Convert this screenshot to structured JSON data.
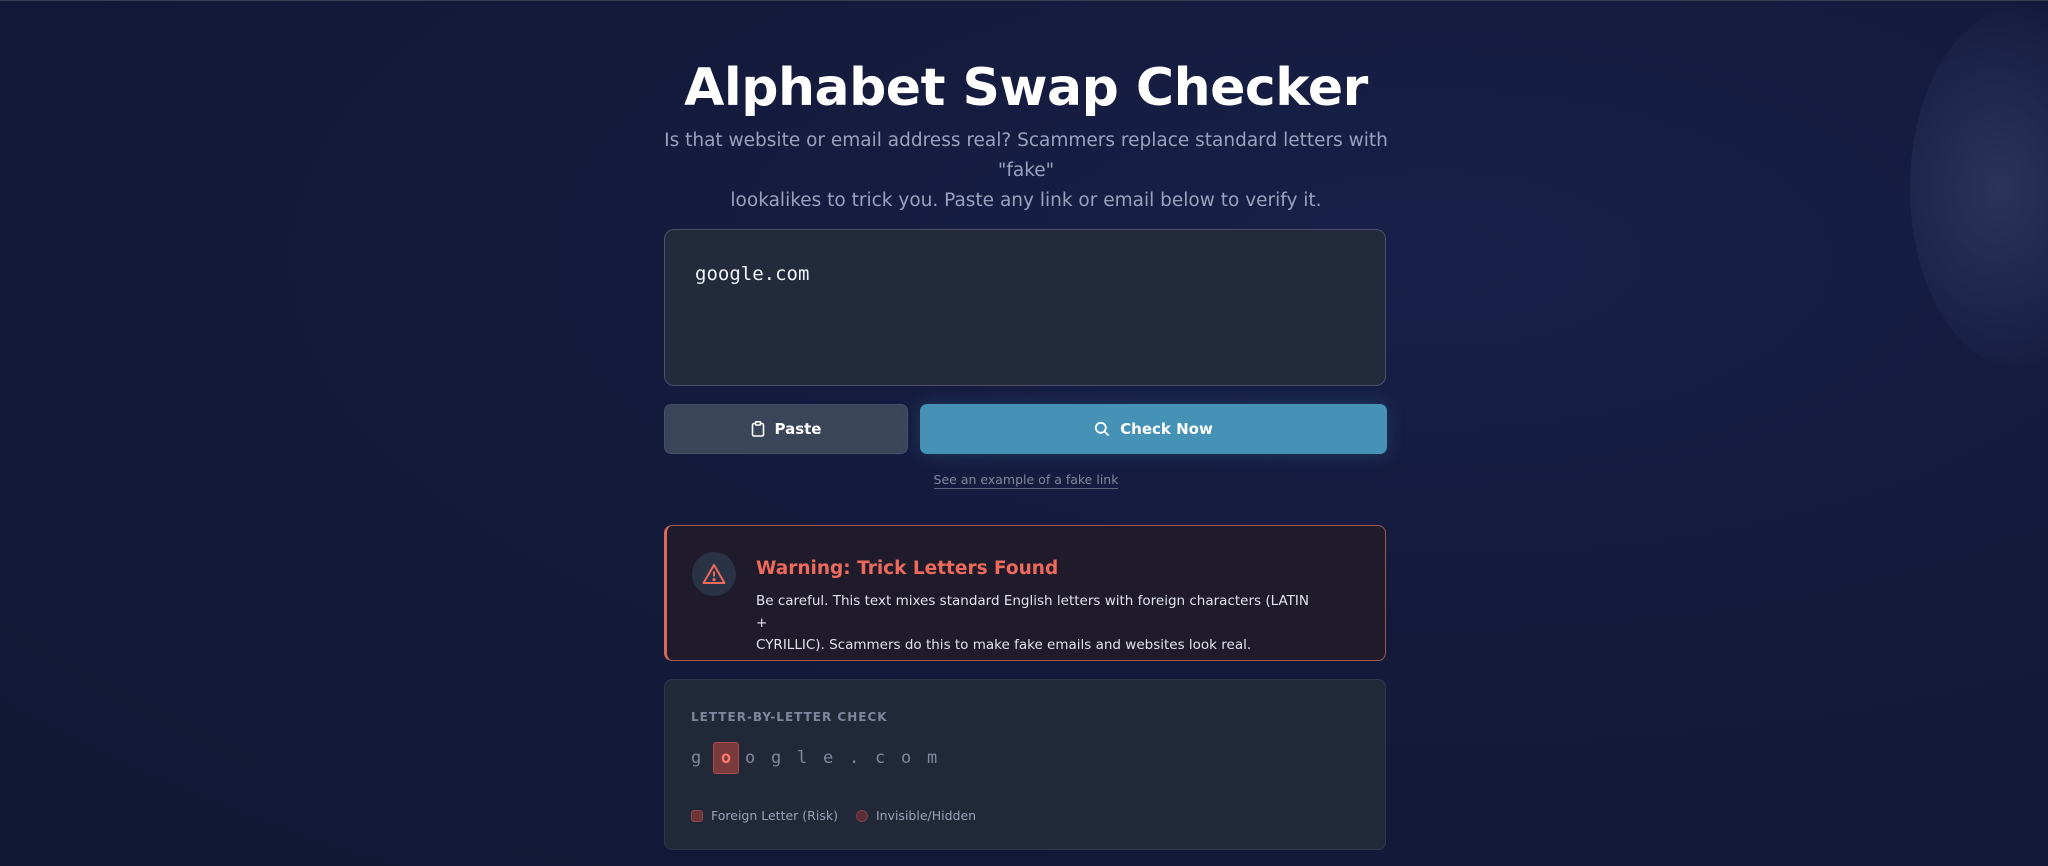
{
  "app": {
    "title": "Alphabet Swap Checker",
    "subtitle_line1": "Is that website or email address real? Scammers replace standard letters with \"fake\"",
    "subtitle_line2": "lookalikes to trick you. Paste any link or email below to verify it."
  },
  "input": {
    "value": "google.com"
  },
  "actions": {
    "paste_label": "Paste",
    "paste_icon": "clipboard-icon",
    "check_label": "Check Now",
    "check_icon": "search-icon",
    "example_link": "See an example of a fake link"
  },
  "warning": {
    "icon": "warning-triangle-icon",
    "title": "Warning: Trick Letters Found",
    "text_line1": "Be careful. This text mixes standard English letters with foreign characters (LATIN +",
    "text_line2": "CYRILLIC). Scammers do this to make fake emails and websites look real."
  },
  "letter_check": {
    "label": "LETTER-BY-LETTER CHECK",
    "letters": [
      {
        "char": "g",
        "risk": false
      },
      {
        "char": "о",
        "risk": true
      },
      {
        "char": "o",
        "risk": false
      },
      {
        "char": "g",
        "risk": false
      },
      {
        "char": "l",
        "risk": false
      },
      {
        "char": "e",
        "risk": false
      },
      {
        "char": ".",
        "risk": false
      },
      {
        "char": "c",
        "risk": false
      },
      {
        "char": "o",
        "risk": false
      },
      {
        "char": "m",
        "risk": false
      }
    ],
    "legend": {
      "risk_label": "Foreign Letter (Risk)",
      "hidden_label": "Invisible/Hidden"
    }
  },
  "colors": {
    "accent": "#4592b6",
    "danger": "#ee6a5d",
    "background": "#141a3a"
  }
}
